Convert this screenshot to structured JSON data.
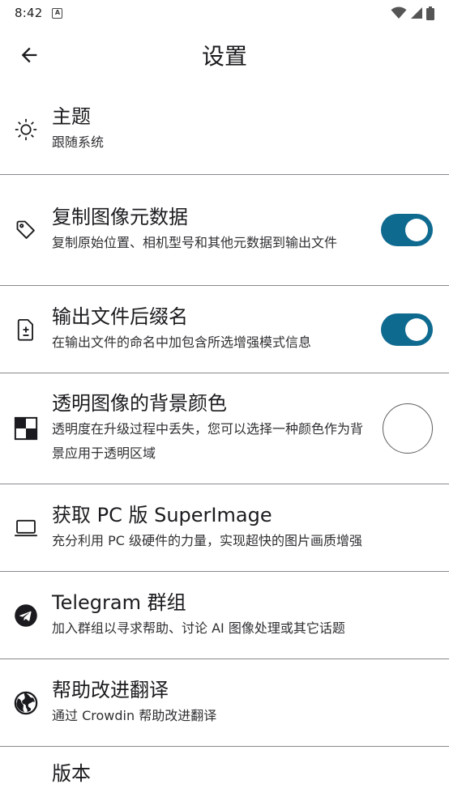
{
  "status_bar": {
    "time": "8:42",
    "notification_badge": "A"
  },
  "app_bar": {
    "title": "设置",
    "back_icon": "arrow-left-icon"
  },
  "settings": [
    {
      "id": "theme",
      "icon": "sun-icon",
      "title": "主题",
      "subtitle": "跟随系统",
      "trailing": "none"
    },
    {
      "id": "copy-metadata",
      "icon": "tag-icon",
      "title": "复制图像元数据",
      "subtitle": "复制原始位置、相机型号和其他元数据到输出文件",
      "trailing": "toggle",
      "enabled": true
    },
    {
      "id": "output-suffix",
      "icon": "file-diff-icon",
      "title": "输出文件后缀名",
      "subtitle": "在输出文件的命名中加包含所选增强模式信息",
      "trailing": "toggle",
      "enabled": true
    },
    {
      "id": "bg-color",
      "icon": "checkerboard-icon",
      "title": "透明图像的背景颜色",
      "subtitle": "透明度在升级过程中丢失，您可以选择一种颜色作为背景应用于透明区域",
      "trailing": "color",
      "color": "#ffffff"
    },
    {
      "id": "pc-version",
      "icon": "laptop-icon",
      "title": "获取 PC 版 SuperImage",
      "subtitle": "充分利用 PC 级硬件的力量，实现超快的图片画质增强",
      "trailing": "none"
    },
    {
      "id": "telegram",
      "icon": "telegram-icon",
      "title": "Telegram 群组",
      "subtitle": "加入群组以寻求帮助、讨论 AI 图像处理或其它话题",
      "trailing": "none"
    },
    {
      "id": "translate",
      "icon": "globe-icon",
      "title": "帮助改进翻译",
      "subtitle": "通过 Crowdin 帮助改进翻译",
      "trailing": "none"
    },
    {
      "id": "version",
      "icon": "none",
      "title": "版本",
      "subtitle": "",
      "trailing": "none"
    }
  ],
  "colors": {
    "toggle_on": "#0f6a90",
    "divider": "#8a8a8f",
    "text_primary": "#1b1b1f"
  }
}
